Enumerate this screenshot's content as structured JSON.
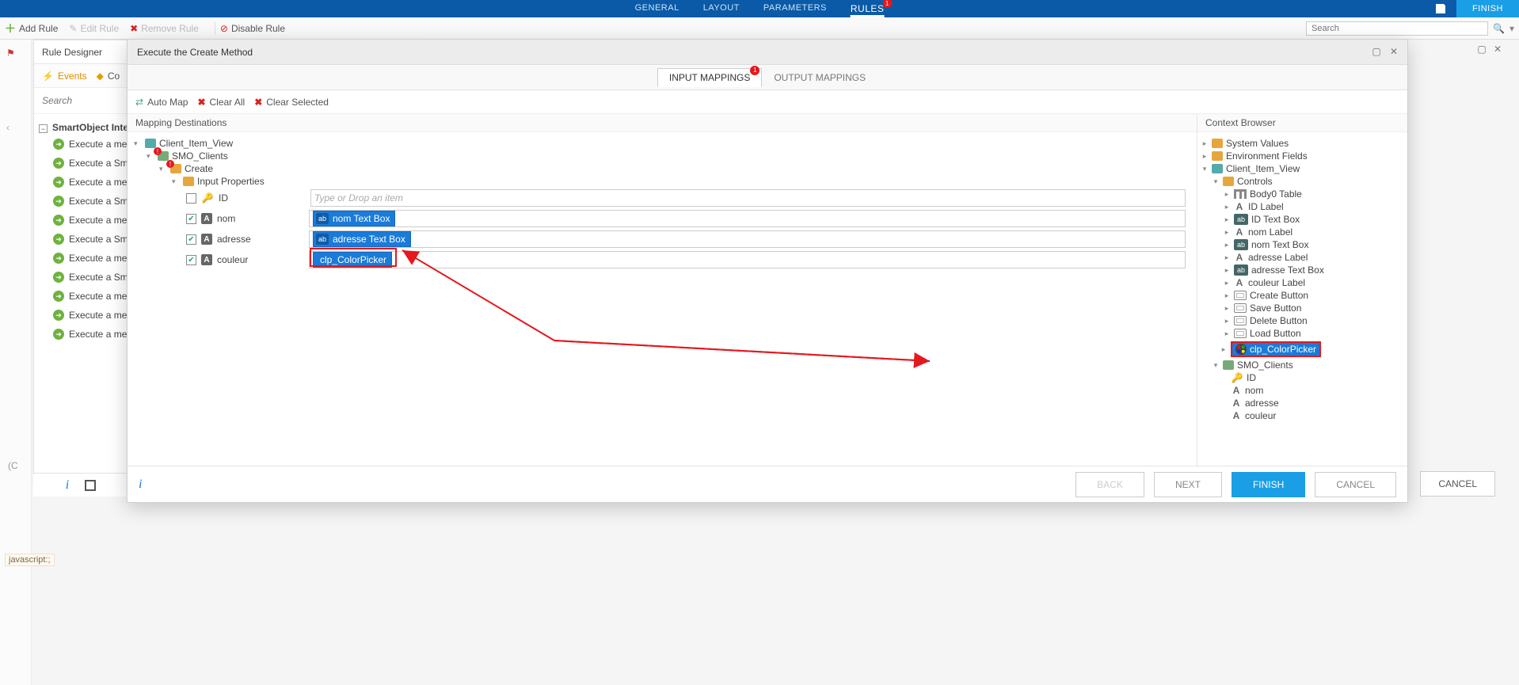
{
  "top_nav": {
    "general": "GENERAL",
    "layout": "LAYOUT",
    "parameters": "PARAMETERS",
    "rules": "RULES",
    "rules_badge": "1",
    "finish": "FINISH"
  },
  "toolbar": {
    "add_rule": "Add Rule",
    "edit_rule": "Edit Rule",
    "remove_rule": "Remove Rule",
    "disable_rule": "Disable Rule",
    "search_placeholder": "Search"
  },
  "rule_designer": {
    "title": "Rule Designer",
    "tab_events": "Events",
    "tab_conditions": "Co",
    "search_placeholder": "Search",
    "root": "SmartObject Interact",
    "items": [
      "Execute a metho",
      "Execute a SmartO",
      "Execute a method changed",
      "Execute a SmartO that have been ch",
      "Execute a method changed on a sub",
      "Execute a SmartO that have been ch",
      "Execute a method changed on a Vie",
      "Execute a SmartO that have been ch subform",
      "Execute a method that are in a spec",
      "Execute a method that are in a spec",
      "Execute a method that are in a spec"
    ]
  },
  "modal": {
    "title": "Execute the Create Method",
    "tab_input": "INPUT MAPPINGS",
    "tab_input_badge": "1",
    "tab_output": "OUTPUT MAPPINGS",
    "toolbar": {
      "auto_map": "Auto Map",
      "clear_all": "Clear All",
      "clear_selected": "Clear Selected"
    },
    "dest_title": "Mapping Destinations",
    "ctx_title": "Context Browser",
    "map_tree": {
      "view": "Client_Item_View",
      "smo": "SMO_Clients",
      "method": "Create",
      "props": "Input Properties",
      "fields": {
        "id": "ID",
        "nom": "nom",
        "adresse": "adresse",
        "couleur": "couleur"
      },
      "placeholder": "Type or Drop an item",
      "pill_nom": "nom Text Box",
      "pill_adresse": "adresse Text Box",
      "pill_couleur": "clp_ColorPicker"
    },
    "ctx_tree": {
      "system_values": "System Values",
      "env_fields": "Environment Fields",
      "view": "Client_Item_View",
      "controls": "Controls",
      "items": {
        "body0": "Body0 Table",
        "id_label": "ID Label",
        "id_text": "ID Text Box",
        "nom_label": "nom Label",
        "nom_text": "nom Text Box",
        "adresse_label": "adresse Label",
        "adresse_text": "adresse Text Box",
        "couleur_label": "couleur Label",
        "create_btn": "Create Button",
        "save_btn": "Save Button",
        "delete_btn": "Delete Button",
        "load_btn": "Load Button",
        "colorpicker": "clp_ColorPicker"
      },
      "smo": "SMO_Clients",
      "smo_fields": {
        "id": "ID",
        "nom": "nom",
        "adresse": "adresse",
        "couleur": "couleur"
      }
    },
    "footer": {
      "back": "BACK",
      "next": "NEXT",
      "finish": "FINISH",
      "cancel": "CANCEL"
    }
  },
  "outer_cancel": "CANCEL",
  "js_text": "javascript:;"
}
